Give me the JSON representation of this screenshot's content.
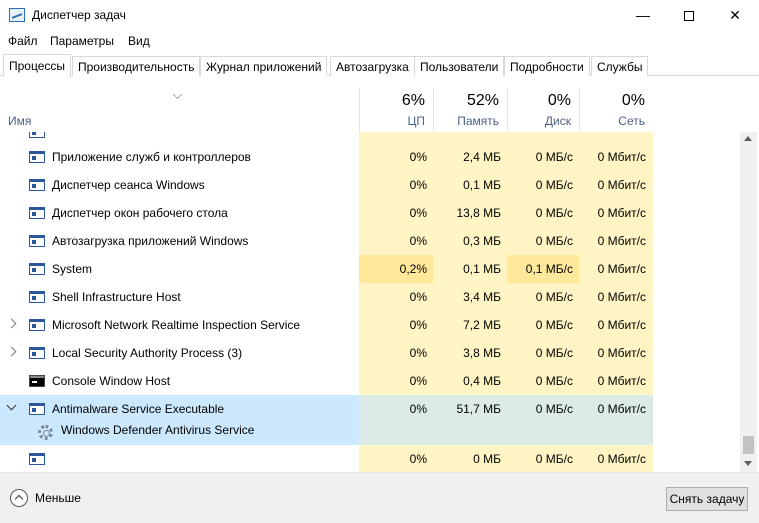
{
  "window": {
    "title": "Диспетчер задач",
    "minimize_glyph": "—",
    "close_glyph": "✕"
  },
  "menu": [
    "Файл",
    "Параметры",
    "Вид"
  ],
  "tabs": [
    "Процессы",
    "Производительность",
    "Журнал приложений",
    "Автозагрузка",
    "Пользователи",
    "Подробности",
    "Службы"
  ],
  "active_tab": "Процессы",
  "columns": {
    "name": "Имя",
    "cpu": {
      "percent": "6%",
      "label": "ЦП"
    },
    "memory": {
      "percent": "52%",
      "label": "Память"
    },
    "disk": {
      "percent": "0%",
      "label": "Диск"
    },
    "network": {
      "percent": "0%",
      "label": "Сеть"
    }
  },
  "processes": [
    {
      "name": "Приложение служб и контроллеров",
      "cpu": "0%",
      "memory": "2,4 МБ",
      "disk": "0 МБ/с",
      "network": "0 Мбит/с"
    },
    {
      "name": "Диспетчер сеанса  Windows",
      "cpu": "0%",
      "memory": "0,1 МБ",
      "disk": "0 МБ/с",
      "network": "0 Мбит/с"
    },
    {
      "name": "Диспетчер окон рабочего стола",
      "cpu": "0%",
      "memory": "13,8 МБ",
      "disk": "0 МБ/с",
      "network": "0 Мбит/с"
    },
    {
      "name": "Автозагрузка приложений Windows",
      "cpu": "0%",
      "memory": "0,3 МБ",
      "disk": "0 МБ/с",
      "network": "0 Мбит/с"
    },
    {
      "name": "System",
      "cpu": "0,2%",
      "memory": "0,1 МБ",
      "disk": "0,1 МБ/с",
      "network": "0 Мбит/с"
    },
    {
      "name": "Shell Infrastructure Host",
      "cpu": "0%",
      "memory": "3,4 МБ",
      "disk": "0 МБ/с",
      "network": "0 Мбит/с"
    },
    {
      "name": "Microsoft Network Realtime Inspection Service",
      "cpu": "0%",
      "memory": "7,2 МБ",
      "disk": "0 МБ/с",
      "network": "0 Мбит/с"
    },
    {
      "name": "Local Security Authority Process (3)",
      "cpu": "0%",
      "memory": "3,8 МБ",
      "disk": "0 МБ/с",
      "network": "0 Мбит/с"
    },
    {
      "name": "Console Window Host",
      "cpu": "0%",
      "memory": "0,4 МБ",
      "disk": "0 МБ/с",
      "network": "0 Мбит/с"
    },
    {
      "name": "Antimalware Service Executable",
      "cpu": "0%",
      "memory": "51,7 МБ",
      "disk": "0 МБ/с",
      "network": "0 Мбит/с"
    },
    {
      "name": "Windows Defender Antivirus Service"
    },
    {
      "name": "",
      "cpu": "0%",
      "memory": "0 МБ",
      "disk": "0 МБ/с",
      "network": "0 Мбит/с"
    }
  ],
  "footer": {
    "less_label": "Меньше",
    "end_task_label": "Снять задачу"
  }
}
